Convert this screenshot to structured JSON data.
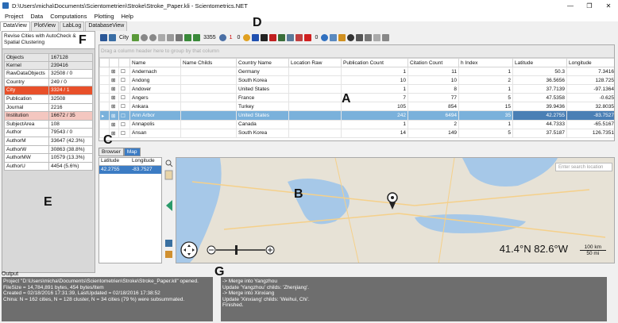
{
  "window": {
    "title": "D:\\Users\\micha\\Documents\\Scientometrien\\Stroke\\Stroke_Paper.kli - Scientometrics.NET",
    "minimize": "—",
    "restore": "❐",
    "close": "✕"
  },
  "menu": [
    "Project",
    "Data",
    "Computations",
    "Plotting",
    "Help"
  ],
  "tabs": [
    "DataView",
    "PlotView",
    "LabLog",
    "DatabaseView"
  ],
  "left_panel": {
    "header": "Revise Cities with AutoCheck & Spatial Clustering",
    "stats": [
      {
        "key": "Objects",
        "value": "167128"
      },
      {
        "key": "Kernel",
        "value": "239416"
      },
      {
        "key": "RawDataObjects",
        "value": "32508 / 0"
      },
      {
        "key": "Country",
        "value": "249 / 0"
      },
      {
        "key": "City",
        "value": "3324 / 1"
      },
      {
        "key": "Publication",
        "value": "32508"
      },
      {
        "key": "Journal",
        "value": "2216"
      },
      {
        "key": "Institution",
        "value": "16672 / 35"
      },
      {
        "key": "SubjectArea",
        "value": "108"
      },
      {
        "key": "Author",
        "value": "79543 / 0"
      },
      {
        "key": "AuthorM",
        "value": "33647 (42.3%)"
      },
      {
        "key": "AuthorW",
        "value": "30863 (38.8%)"
      },
      {
        "key": "AuthorMW",
        "value": "10579 (13.3%)"
      },
      {
        "key": "AuthorU",
        "value": "4454 (5.6%)"
      }
    ]
  },
  "toolbar": {
    "city_label": "City",
    "count": "3355",
    "red_count": "1",
    "zero_count": "0"
  },
  "grid": {
    "group_hint": "Drag a column header here to group by that column",
    "columns": [
      "Name",
      "Name Childs",
      "Country Name",
      "Location Raw",
      "Publication Count",
      "Citation Count",
      "h Index",
      "Latitude",
      "Longitude"
    ],
    "rows": [
      [
        "Andernach",
        "",
        "Germany",
        "",
        "1",
        "11",
        "1",
        "50.3",
        "7.3416"
      ],
      [
        "Andong",
        "",
        "South Korea",
        "",
        "10",
        "10",
        "2",
        "36.5656",
        "128.725"
      ],
      [
        "Andover",
        "",
        "United States",
        "",
        "1",
        "8",
        "1",
        "37.7139",
        "-97.1364"
      ],
      [
        "Angers",
        "",
        "France",
        "",
        "7",
        "77",
        "5",
        "47.5358",
        "-0.625"
      ],
      [
        "Ankara",
        "",
        "Turkey",
        "",
        "105",
        "854",
        "15",
        "39.9436",
        "32.8035"
      ],
      [
        "Ann Arbor",
        "",
        "United States",
        "",
        "242",
        "6494",
        "35",
        "42.2755",
        "-83.7527"
      ],
      [
        "Annapolis",
        "",
        "Canada",
        "",
        "1",
        "2",
        "1",
        "44.7333",
        "-65.5167"
      ],
      [
        "Ansan",
        "",
        "South Korea",
        "",
        "14",
        "149",
        "5",
        "37.5187",
        "126.7351"
      ]
    ],
    "selected_row": 5
  },
  "browser_tabs": [
    "Browser",
    "Map"
  ],
  "coords": {
    "lat_label": "Latitude",
    "lon_label": "Longitude",
    "lat": "42.2755",
    "lon": "-83.7527"
  },
  "map": {
    "search_placeholder": "Enter search location",
    "lat_text": "41.4°N",
    "lon_text": "82.6°W",
    "scale_km": "100 km",
    "scale_mi": "50 mi"
  },
  "output": {
    "label": "Output",
    "left_lines": [
      "Project \"D:\\Users\\micha\\Documents\\Scientometrien\\Stroke\\Stroke_Paper.kli\" opened.",
      "FileSize = 14,784,891 bytes, 454 bytes/Item",
      "Created = 02/18/2016 17:31:39, LastUpdated = 02/18/2016 17:38:52",
      "China: N = 162 cities, N = 128 cluster, N = 34 cities (79 %) were subsummated."
    ],
    "right_lines": [
      "-> Merge into Yangzhou",
      "Update 'Yangzhou' childs: 'Zhenjiang'.",
      "-> Merge into Xinxiang",
      "Update 'Xinxiang' childs: 'Weihui, Chi'.",
      "Finished."
    ]
  },
  "annotations": [
    "A",
    "B",
    "C",
    "D",
    "E",
    "F",
    "G"
  ],
  "colors": {
    "selection": "#7ab1db",
    "highlight": "#e8502a",
    "output_bg": "#6e6e6e"
  }
}
